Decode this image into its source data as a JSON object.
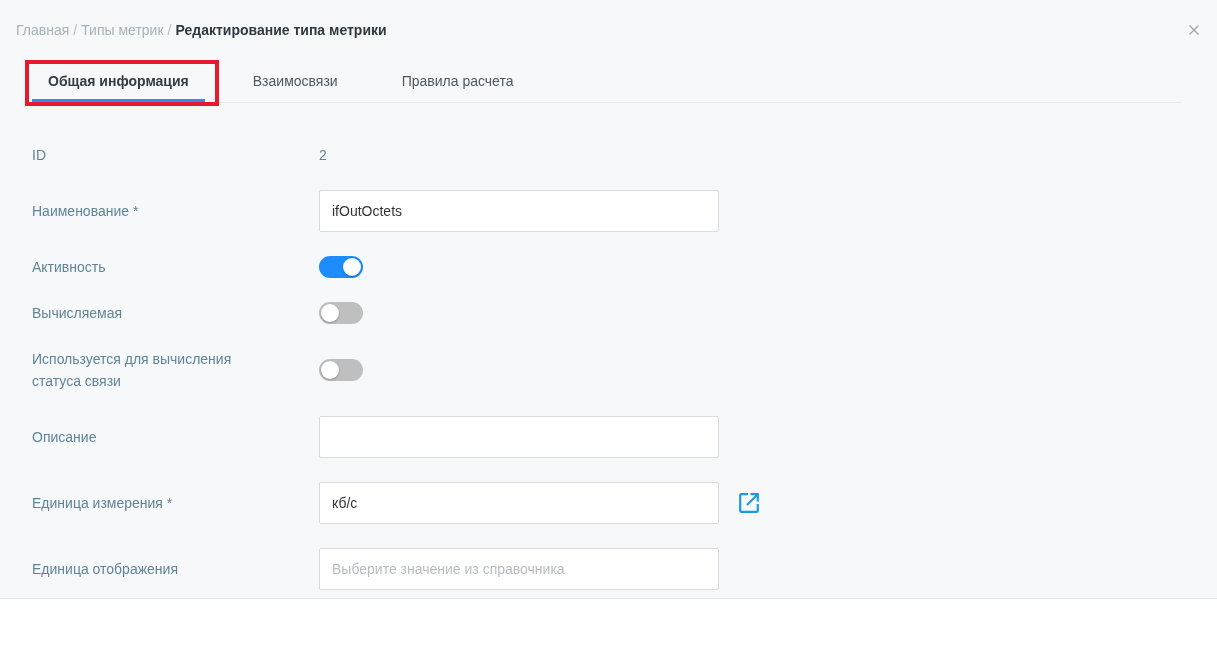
{
  "breadcrumb": [
    {
      "label": "Главная",
      "current": false,
      "separator": "/"
    },
    {
      "label": "Типы метрик",
      "current": false,
      "separator": "/"
    },
    {
      "label": "Редактирование типа метрики",
      "current": true
    }
  ],
  "tabs": [
    {
      "label": "Общая информация",
      "selected": true,
      "highlighted": true
    },
    {
      "label": "Взаимосвязи",
      "selected": false,
      "highlighted": false
    },
    {
      "label": "Правила расчета",
      "selected": false,
      "highlighted": false
    }
  ],
  "fields": [
    {
      "kind": "readonly",
      "label": "ID",
      "value": "2"
    },
    {
      "kind": "text",
      "label": "Наименование *",
      "value": "ifOutOctets"
    },
    {
      "kind": "toggle",
      "label": "Активность",
      "on": true
    },
    {
      "kind": "toggle",
      "label": "Вычисляемая",
      "on": false
    },
    {
      "kind": "toggle",
      "label": "Используется для вычисления статуса связи",
      "on": false
    },
    {
      "kind": "text",
      "label": "Описание"
    },
    {
      "kind": "reference",
      "label": "Единица измерения *",
      "value": "кб/с"
    },
    {
      "kind": "text",
      "label": "Единица отображения",
      "placeholder": "Выберите значение из справочника"
    }
  ]
}
